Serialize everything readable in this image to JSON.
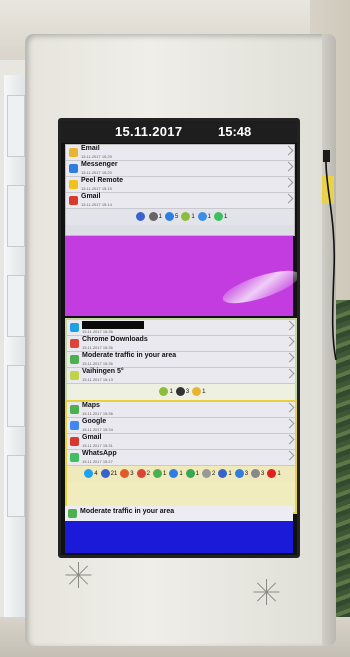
{
  "screen": {
    "date": "15.11.2017",
    "time": "15:48"
  },
  "panel_top": {
    "notifications": [
      {
        "title": "Email",
        "sub": "15.11.2017 15:29",
        "icon": "email-icon",
        "color": "#e7b533"
      },
      {
        "title": "Messenger",
        "sub": "15.11.2017 15:20",
        "icon": "messenger-icon",
        "color": "#2f7de1"
      },
      {
        "title": "Peel Remote",
        "sub": "15.11.2017 15:15",
        "icon": "peel-remote-icon",
        "color": "#f0c21a"
      },
      {
        "title": "Gmail",
        "sub": "15.11.2017 15:14",
        "icon": "gmail-icon",
        "color": "#d9382c"
      }
    ],
    "counts": [
      {
        "icon": "app-icon",
        "color": "#3a63c9",
        "count": ""
      },
      {
        "icon": "settings-icon",
        "color": "#666666",
        "count": "1"
      },
      {
        "icon": "messenger-icon",
        "color": "#2f7de1",
        "count": "5"
      },
      {
        "icon": "android-icon",
        "color": "#8bbd3b",
        "count": "1"
      },
      {
        "icon": "chart-icon",
        "color": "#3a8ee6",
        "count": "1"
      },
      {
        "icon": "whatsapp-icon",
        "color": "#3fbf5f",
        "count": "1"
      }
    ]
  },
  "panel_middle": {
    "notifications": [
      {
        "title": "",
        "sub": "15.11.2017 15:36",
        "icon": "skype-icon",
        "color": "#1ea0e6",
        "redacted": true
      },
      {
        "title": "Chrome Downloads",
        "sub": "15.11.2017 15:36",
        "icon": "chrome-icon",
        "color": "#db4437"
      },
      {
        "title": "Moderate traffic in your area",
        "sub": "15.11.2017 15:36",
        "icon": "maps-icon",
        "color": "#4caf50"
      },
      {
        "title": "Vaihingen 5°",
        "sub": "15.11.2017 15:13",
        "icon": "weather-icon",
        "color": "#c0d34a"
      }
    ],
    "counts": [
      {
        "icon": "android-icon",
        "color": "#8bbd3b",
        "count": "1"
      },
      {
        "icon": "news-icon",
        "color": "#333333",
        "count": "3"
      },
      {
        "icon": "weather-icon",
        "color": "#e7b533",
        "count": "1"
      }
    ]
  },
  "panel_bottom": {
    "notifications": [
      {
        "title": "Maps",
        "sub": "15.11.2017 15:36",
        "icon": "maps-icon",
        "color": "#4caf50"
      },
      {
        "title": "Google",
        "sub": "15.11.2017 15:34",
        "icon": "google-icon",
        "color": "#4285f4"
      },
      {
        "title": "Gmail",
        "sub": "15.11.2017 15:31",
        "icon": "gmail-icon",
        "color": "#d9382c"
      },
      {
        "title": "WhatsApp",
        "sub": "15.11.2017 15:27",
        "icon": "whatsapp-icon",
        "color": "#3fbf5f"
      }
    ],
    "counts": [
      {
        "icon": "twitter-icon",
        "color": "#1da1f2",
        "count": "4"
      },
      {
        "icon": "calendar-icon",
        "color": "#3a63c9",
        "count": "21"
      },
      {
        "icon": "flag-icon",
        "color": "#e05b2a",
        "count": "3"
      },
      {
        "icon": "chrome-icon",
        "color": "#db4437",
        "count": "2"
      },
      {
        "icon": "maps-icon",
        "color": "#4caf50",
        "count": "1"
      },
      {
        "icon": "messenger-icon",
        "color": "#2f7de1",
        "count": "1"
      },
      {
        "icon": "play-icon",
        "color": "#34a853",
        "count": "1"
      },
      {
        "icon": "drive-icon",
        "color": "#999999",
        "count": "2"
      },
      {
        "icon": "docs-icon",
        "color": "#3a63c9",
        "count": "1"
      },
      {
        "icon": "contacts-icon",
        "color": "#2f7de1",
        "count": "3"
      },
      {
        "icon": "sheets-icon",
        "color": "#888888",
        "count": "3"
      },
      {
        "icon": "youtube-icon",
        "color": "#e02020",
        "count": "1"
      }
    ]
  },
  "panel_blue": {
    "title": "Moderate traffic in your area",
    "icon": "maps-icon",
    "color": "#4caf50"
  },
  "colors": {
    "magenta_block": "#c23ce0",
    "blue_block": "#1a1ad8",
    "middle_border": "#c7d7a0",
    "bottom_border": "#e7d23b"
  }
}
